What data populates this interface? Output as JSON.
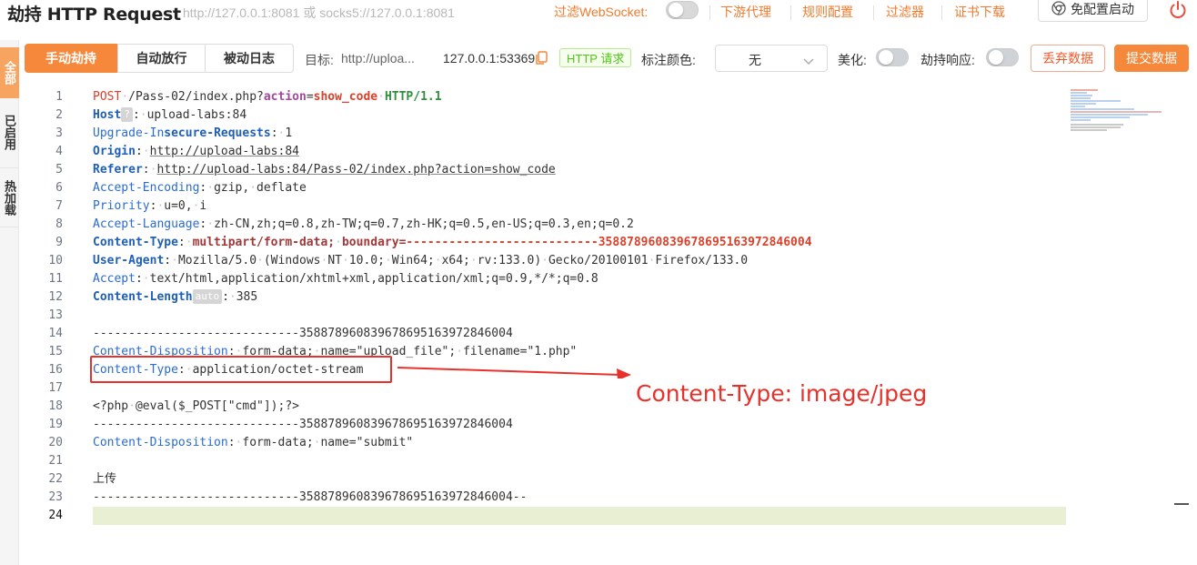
{
  "app": {
    "title": "劫持 HTTP Request",
    "proxy_address": "http://127.0.0.1:8081 或 socks5://127.0.0.1:8081"
  },
  "topnav": {
    "filter_websocket": "过滤WebSocket:",
    "downstream_proxy": "下游代理",
    "rule_config": "规则配置",
    "filter": "过滤器",
    "cert_download": "证书下载",
    "launch_button": "免配置启动"
  },
  "sidebar": {
    "tabs": [
      {
        "label": "全部"
      },
      {
        "label": "已启用"
      },
      {
        "label": "热加载"
      }
    ]
  },
  "toolbar": {
    "tabs": [
      {
        "label": "手动劫持"
      },
      {
        "label": "自动放行"
      },
      {
        "label": "被动日志"
      }
    ],
    "target_label": "目标:",
    "target_value": "http://uploa...",
    "client_addr": "127.0.0.1:53369",
    "request_badge": "HTTP 请求",
    "mark_color_label": "标注颜色:",
    "mark_color_value": "无",
    "beautify_label": "美化:",
    "hijack_response_label": "劫持响应:",
    "discard_button": "丢弃数据",
    "submit_button": "提交数据"
  },
  "editor": {
    "line_numbers": [
      "1",
      "2",
      "3",
      "4",
      "5",
      "6",
      "7",
      "8",
      "9",
      "10",
      "11",
      "12",
      "13",
      "14",
      "15",
      "16",
      "17",
      "18",
      "19",
      "20",
      "21",
      "22",
      "23",
      "24"
    ],
    "host_hint": "?",
    "length_hint": "auto",
    "annotation": "Content-Type: image/jpeg"
  }
}
